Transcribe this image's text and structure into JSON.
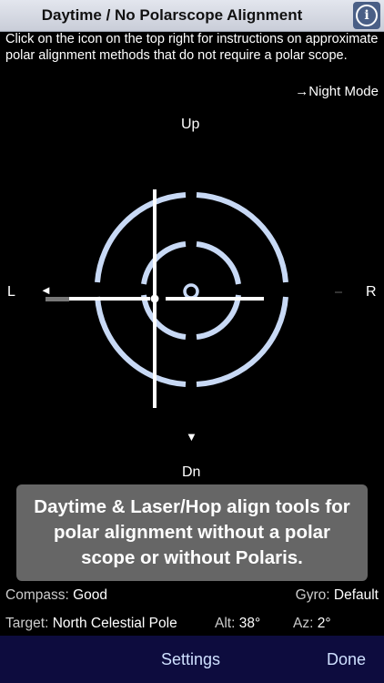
{
  "header": {
    "title": "Daytime / No Polarscope Alignment",
    "info_icon": "info-icon"
  },
  "instructions": "Click on the icon on the top right for instructions on approximate polar alignment methods that do not require a polar scope.",
  "night_mode_link": "→Night Mode",
  "direction_labels": {
    "up": "Up",
    "down": "Dn",
    "left": "L",
    "right": "R"
  },
  "arrows": {
    "left": "◄",
    "down": "▼"
  },
  "banner": "Daytime & Laser/Hop align tools for polar alignment without a polar scope or without Polaris.",
  "status": {
    "compass_label": "Compass:",
    "compass_value": "Good",
    "gyro_label": "Gyro:",
    "gyro_value": "Default",
    "target_label": "Target:",
    "target_value": "North Celestial Pole",
    "alt_label": "Alt:",
    "alt_value": "38°",
    "az_label": "Az:",
    "az_value": "2°"
  },
  "tabbar": {
    "settings": "Settings",
    "done": "Done"
  },
  "colors": {
    "reticle": "#c8d9f5",
    "tabbar": "#0d0c3e",
    "banner": "#666666"
  }
}
